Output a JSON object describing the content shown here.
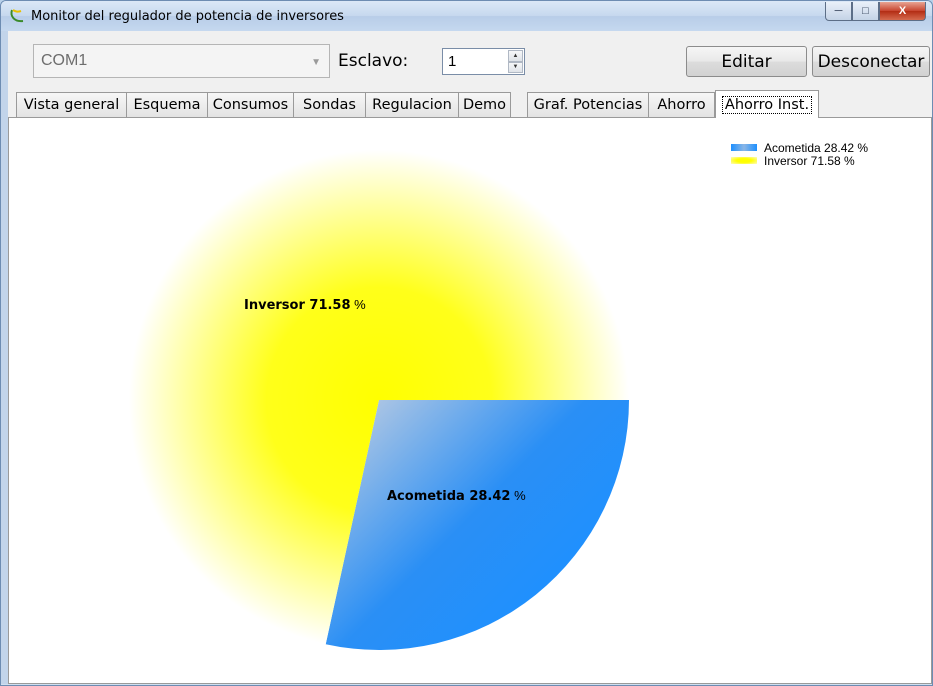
{
  "window": {
    "title": "Monitor del regulador de potencia de inversores",
    "controls": {
      "minimize": "─",
      "maximize": "□",
      "close": "X"
    }
  },
  "toolbar": {
    "port_value": "COM1",
    "slave_label": "Esclavo:",
    "slave_value": "1",
    "edit_label": "Editar",
    "disconnect_label": "Desconectar"
  },
  "tabs": [
    {
      "label": "Vista general",
      "active": false
    },
    {
      "label": "Esquema",
      "active": false
    },
    {
      "label": "Consumos",
      "active": false
    },
    {
      "label": "Sondas",
      "active": false
    },
    {
      "label": "Regulacion",
      "active": false
    },
    {
      "label": "Demo",
      "active": false
    },
    {
      "label": "Graf. Potencias",
      "active": false
    },
    {
      "label": "Ahorro",
      "active": false
    },
    {
      "label": "Ahorro Inst.",
      "active": true
    }
  ],
  "chart_data": {
    "type": "pie",
    "slices": [
      {
        "name": "Acometida",
        "value": 28.42,
        "label_name": "Acometida 28.42",
        "label_unit": " %",
        "legend": "Acometida 28.42 %",
        "color": "#1e90ff"
      },
      {
        "name": "Inversor",
        "value": 71.58,
        "label_name": "Inversor 71.58",
        "label_unit": " %",
        "legend": "Inversor 71.58 %",
        "color": "#ffff00"
      }
    ],
    "start_angle_deg": 0,
    "direction": "clockwise",
    "legend_position": "top-right"
  }
}
